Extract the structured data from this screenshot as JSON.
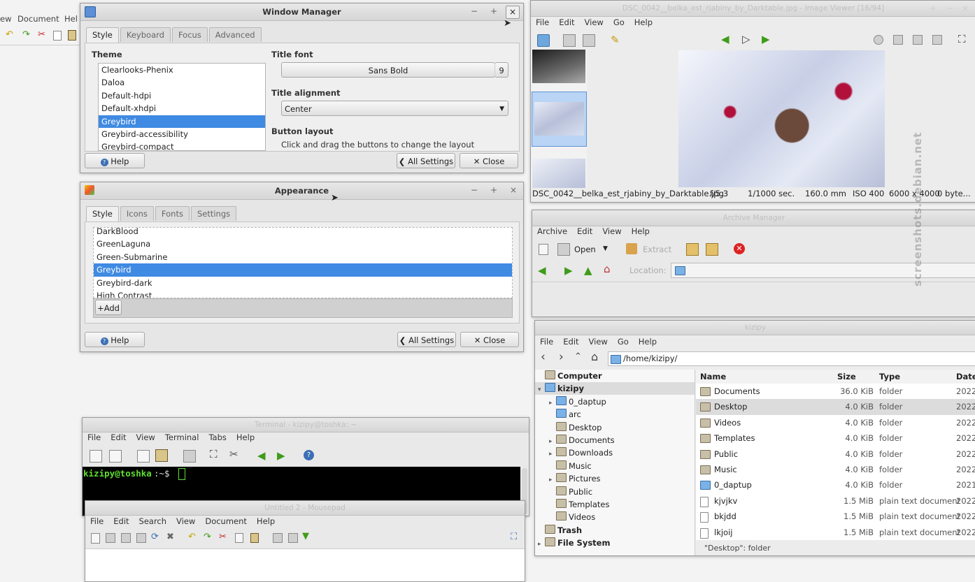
{
  "bg_menu": [
    "ew",
    "Document",
    "Hel"
  ],
  "wm": {
    "title": "Window Manager",
    "tabs": [
      "Style",
      "Keyboard",
      "Focus",
      "Advanced"
    ],
    "theme_label": "Theme",
    "themes": [
      "Clearlooks-Phenix",
      "Daloa",
      "Default-hdpi",
      "Default-xhdpi",
      "Greybird",
      "Greybird-accessibility",
      "Greybird-compact"
    ],
    "selected_theme": "Greybird",
    "title_font_label": "Title font",
    "title_font": "Sans Bold",
    "title_font_size": "9",
    "title_alignment_label": "Title alignment",
    "title_alignment": "Center",
    "button_layout_label": "Button layout",
    "button_layout_hint": "Click and drag the buttons to change the layout",
    "help": "Help",
    "all_settings": "All Settings",
    "close": "Close",
    "wc": [
      "−",
      "+",
      "×"
    ]
  },
  "appearance": {
    "title": "Appearance",
    "tabs": [
      "Style",
      "Icons",
      "Fonts",
      "Settings"
    ],
    "themes": [
      "DarkBlood",
      "GreenLaguna",
      "Green-Submarine",
      "Greybird",
      "Greybird-dark",
      "High Contrast"
    ],
    "selected_theme": "Greybird",
    "add": "Add",
    "help": "Help",
    "all_settings": "All Settings",
    "close": "Close",
    "wc": [
      "−",
      "+",
      "×"
    ]
  },
  "viewer": {
    "title": "DSC_0042__belka_est_rjabiny_by_Darktable.jpg - Image Viewer [16/94]",
    "menu": [
      "File",
      "Edit",
      "View",
      "Go",
      "Help"
    ],
    "status": {
      "file": "DSC_0042__belka_est_rjabiny_by_Darktable.jpg",
      "aperture": "f/5.3",
      "shutter": "1/1000 sec.",
      "focal": "160.0 mm",
      "iso": "ISO 400",
      "dims": "6000 x 4000",
      "size": "0 byte..."
    }
  },
  "archive": {
    "title": "Archive Manager",
    "menu": [
      "Archive",
      "Edit",
      "View",
      "Help"
    ],
    "open": "Open",
    "extract": "Extract",
    "location": "Location:"
  },
  "files": {
    "title": "kizipy",
    "menu": [
      "File",
      "Edit",
      "View",
      "Go",
      "Help"
    ],
    "path": "/home/kizipy/",
    "tree": [
      {
        "label": "Computer",
        "bold": true,
        "indent": 0,
        "exp": ""
      },
      {
        "label": "kizipy",
        "bold": true,
        "indent": 0,
        "exp": "▾",
        "sel": true
      },
      {
        "label": "0_daptup",
        "indent": 2,
        "exp": "▸"
      },
      {
        "label": "arc",
        "indent": 2,
        "exp": ""
      },
      {
        "label": "Desktop",
        "indent": 2,
        "exp": ""
      },
      {
        "label": "Documents",
        "indent": 2,
        "exp": "▸"
      },
      {
        "label": "Downloads",
        "indent": 2,
        "exp": "▸"
      },
      {
        "label": "Music",
        "indent": 2,
        "exp": ""
      },
      {
        "label": "Pictures",
        "indent": 2,
        "exp": "▸"
      },
      {
        "label": "Public",
        "indent": 2,
        "exp": ""
      },
      {
        "label": "Templates",
        "indent": 2,
        "exp": ""
      },
      {
        "label": "Videos",
        "indent": 2,
        "exp": ""
      },
      {
        "label": "Trash",
        "bold": true,
        "indent": 0,
        "exp": ""
      },
      {
        "label": "File System",
        "bold": true,
        "indent": 0,
        "exp": "▸"
      }
    ],
    "columns": [
      "Name",
      "Size",
      "Type",
      "Date"
    ],
    "rows": [
      {
        "name": "Documents",
        "size": "36.0 KiB",
        "type": "folder",
        "date": "2022-"
      },
      {
        "name": "Desktop",
        "size": "4.0 KiB",
        "type": "folder",
        "date": "2022-",
        "sel": true
      },
      {
        "name": "Videos",
        "size": "4.0 KiB",
        "type": "folder",
        "date": "2022-"
      },
      {
        "name": "Templates",
        "size": "4.0 KiB",
        "type": "folder",
        "date": "2022-"
      },
      {
        "name": "Public",
        "size": "4.0 KiB",
        "type": "folder",
        "date": "2022-"
      },
      {
        "name": "Music",
        "size": "4.0 KiB",
        "type": "folder",
        "date": "2022-"
      },
      {
        "name": "0_daptup",
        "size": "4.0 KiB",
        "type": "folder",
        "date": "2021-"
      },
      {
        "name": "kjvjkv",
        "size": "1.5 MiB",
        "type": "plain text document",
        "date": "2022-"
      },
      {
        "name": "bkjdd",
        "size": "1.5 MiB",
        "type": "plain text document",
        "date": "2022-"
      },
      {
        "name": "lkjoij",
        "size": "1.5 MiB",
        "type": "plain text document",
        "date": "2022-"
      }
    ],
    "status": "\"Desktop\": folder"
  },
  "terminal": {
    "title": "Terminal - kizipy@toshka: ~",
    "menu": [
      "File",
      "Edit",
      "View",
      "Terminal",
      "Tabs",
      "Help"
    ],
    "prompt_user": "kizipy@toshka",
    "prompt_path": ":~$"
  },
  "mousepad": {
    "title": "Untitled 2 - Mousepad",
    "menu": [
      "File",
      "Edit",
      "Search",
      "View",
      "Document",
      "Help"
    ]
  },
  "watermark": "screenshots.debian.net"
}
